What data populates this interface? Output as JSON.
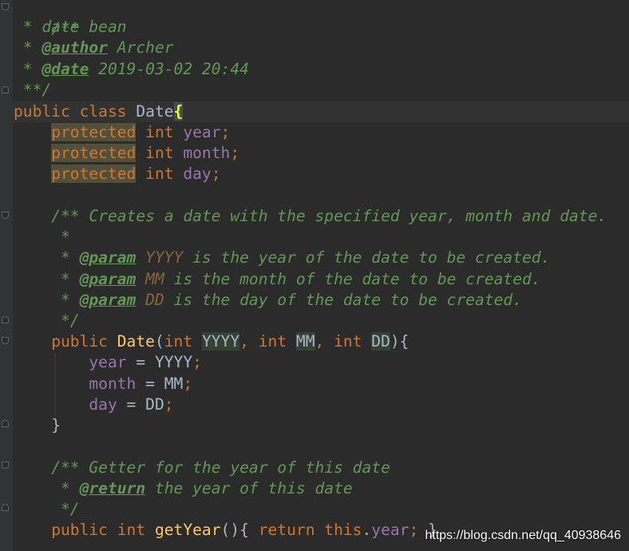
{
  "code": {
    "l1": "/**",
    "l2_star": " * ",
    "l2_text": "date bean",
    "l3_star": " * ",
    "l3_tag": "@author",
    "l3_text": " Archer",
    "l4_star": " * ",
    "l4_tag": "@date",
    "l4_text": " 2019-03-02 20:44",
    "l5": " **/",
    "l6_public": "public",
    "l6_class": "class",
    "l6_name": "Date",
    "l6_brace": "{",
    "f_protected": "protected",
    "f_int": "int",
    "f_year": "year",
    "f_month": "month",
    "f_day": "day",
    "semi": ";",
    "l11_open": "/** ",
    "l11_text": "Creates a date with the specified year, month and date.",
    "l12_star": " *",
    "doc_star": " * ",
    "param_tag": "@param",
    "p_yyyy": "YYYY",
    "p_yyyy_text": " is the year of the date to be created.",
    "p_mm": "MM",
    "p_mm_text": " is the month of the date to be created.",
    "p_dd": "DD",
    "p_dd_text": " is the day of the date to be created.",
    "l16": " */",
    "c_public": "public",
    "c_name": "Date",
    "c_open": "(",
    "c_int": "int",
    "c_comma": ", ",
    "c_close": "){",
    "a_year": "year",
    "a_yyyy": " = YYYY",
    "a_month": "month",
    "a_mm": " = MM",
    "a_day": "day",
    "a_dd": " = DD",
    "close_brace": "}",
    "g_open": "/** ",
    "g_text": "Getter for the year of this date",
    "g_star": " * ",
    "g_tag": "@return",
    "g_ret": " the year of this date",
    "g_end": " */",
    "m_public": "public",
    "m_int": "int",
    "m_name": "getYear",
    "m_parens": "(){ ",
    "m_return": "return",
    "m_this": "this",
    "m_dot": ".",
    "m_year": "year",
    "m_semi": ";",
    "m_close": " }"
  },
  "watermark": "https://blog.csdn.net/qq_40938646"
}
